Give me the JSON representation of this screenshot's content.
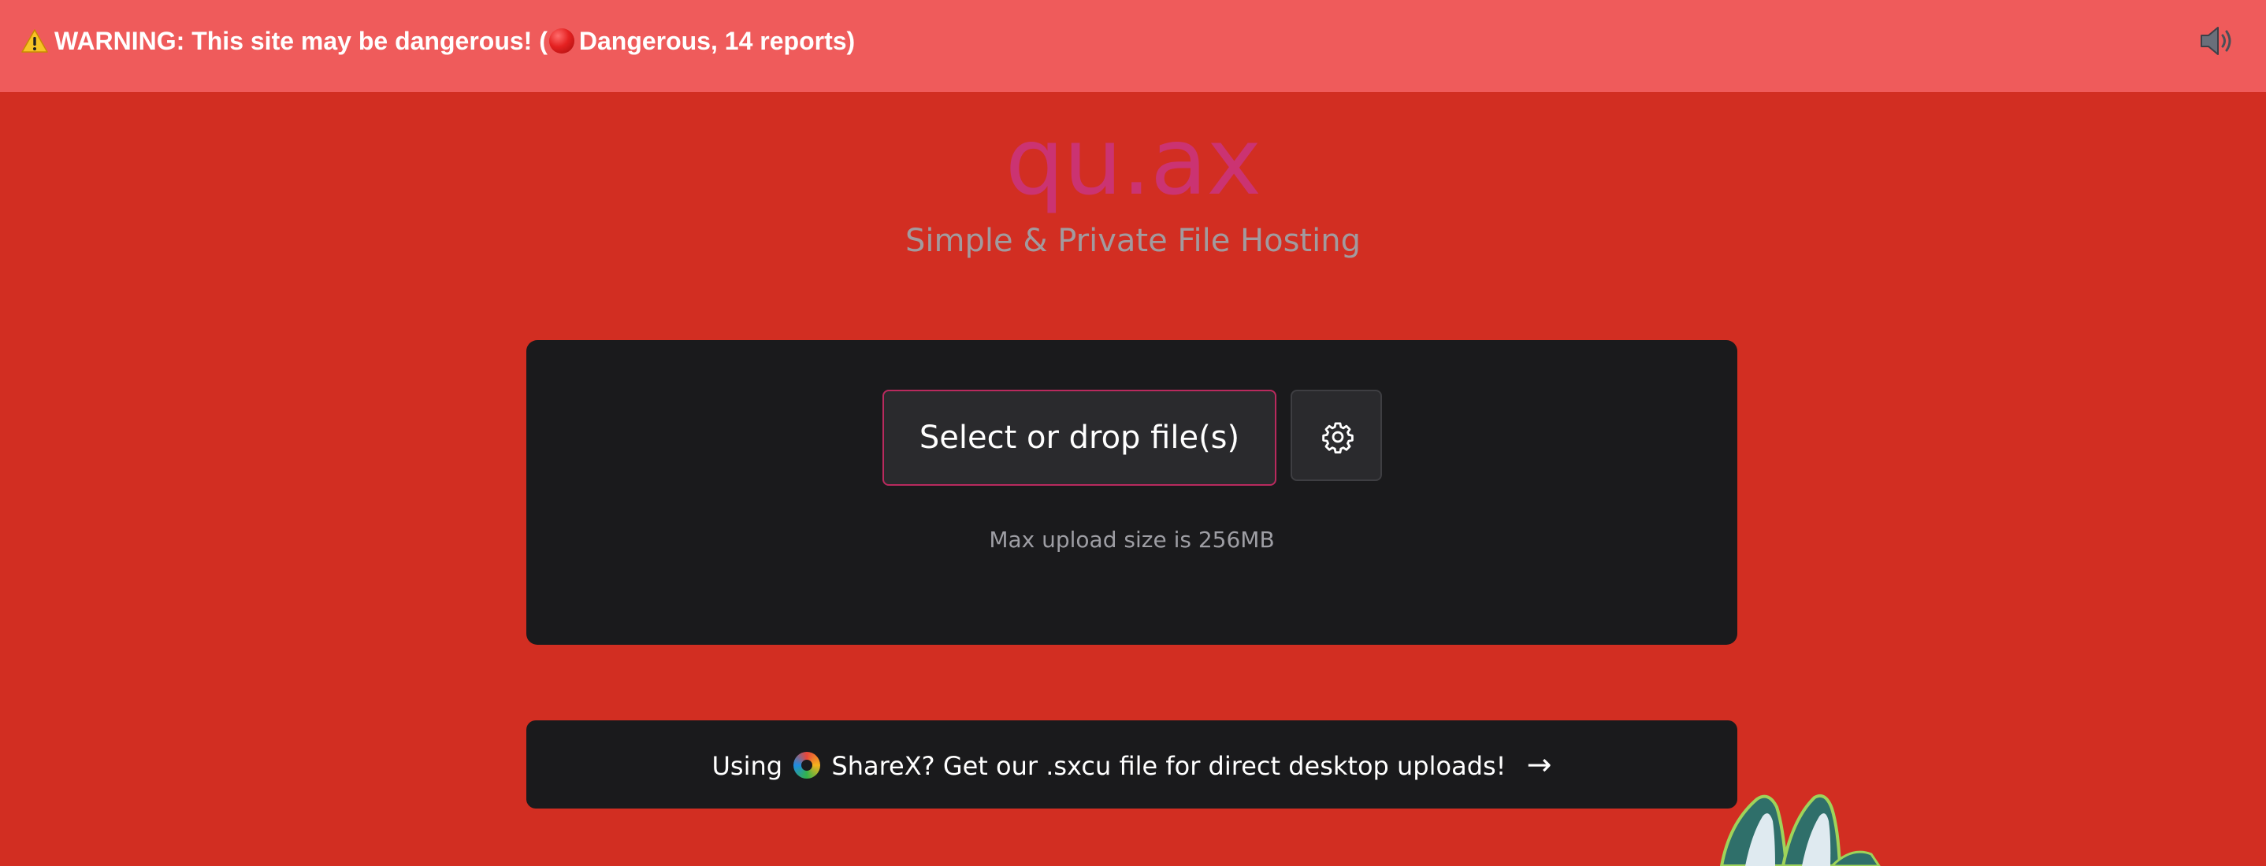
{
  "warning": {
    "prefix": "WARNING: This site may be dangerous! (",
    "status": "Dangerous, 14 reports)",
    "icon": "warning-icon",
    "status_icon": "red-circle-icon"
  },
  "controls": {
    "sound_icon": "speaker-icon"
  },
  "brand": {
    "title": "qu.ax",
    "subtitle": "Simple & Private File Hosting",
    "title_color": "#cb3372"
  },
  "upload": {
    "select_label": "Select or drop file(s)",
    "settings_icon": "gear-icon",
    "max_size_text": "Max upload size is 256MB",
    "accent_color": "#b92a5e"
  },
  "sharex": {
    "before_logo": "Using",
    "text": "ShareX? Get our .sxcu file for direct desktop uploads!",
    "arrow": "→",
    "logo_icon": "sharex-logo-icon"
  },
  "colors": {
    "background": "#d22e22",
    "warning_bar": "#ef5b5b",
    "card": "#1a1a1c"
  }
}
